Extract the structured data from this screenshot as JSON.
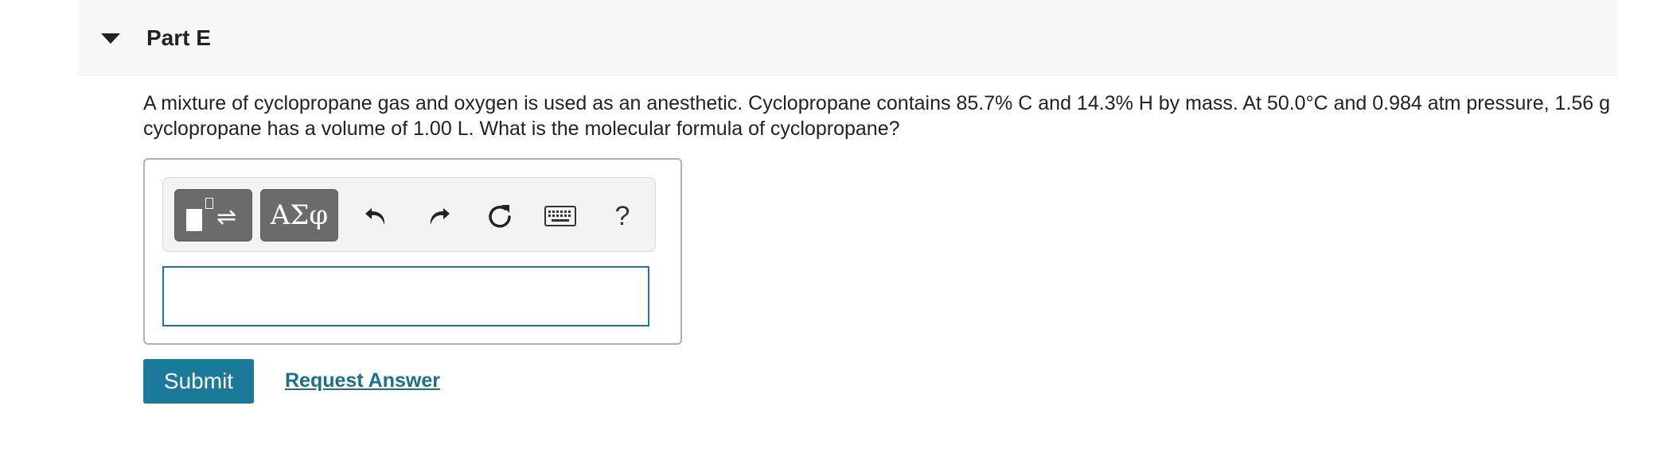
{
  "part": {
    "title": "Part E"
  },
  "question": {
    "text": "A mixture of cyclopropane gas and oxygen is used as an anesthetic. Cyclopropane contains 85.7% C and 14.3% H by mass. At 50.0°C and 0.984 atm pressure, 1.56 g cyclopropane has a volume of 1.00 L. What is the molecular formula of cyclopropane?"
  },
  "toolbar": {
    "greek_label": "ΑΣφ",
    "help_label": "?",
    "icons": [
      "templates-icon",
      "greek-symbols-icon",
      "undo-icon",
      "redo-icon",
      "reset-icon",
      "keyboard-icon",
      "help-icon"
    ]
  },
  "answer": {
    "value": "",
    "placeholder": ""
  },
  "actions": {
    "submit_label": "Submit",
    "request_answer_label": "Request Answer"
  },
  "colors": {
    "accent": "#1b7a9a",
    "link": "#1b6f8e",
    "header_bg": "#f7f7f7",
    "toolbar_button": "#6b6b6b"
  }
}
